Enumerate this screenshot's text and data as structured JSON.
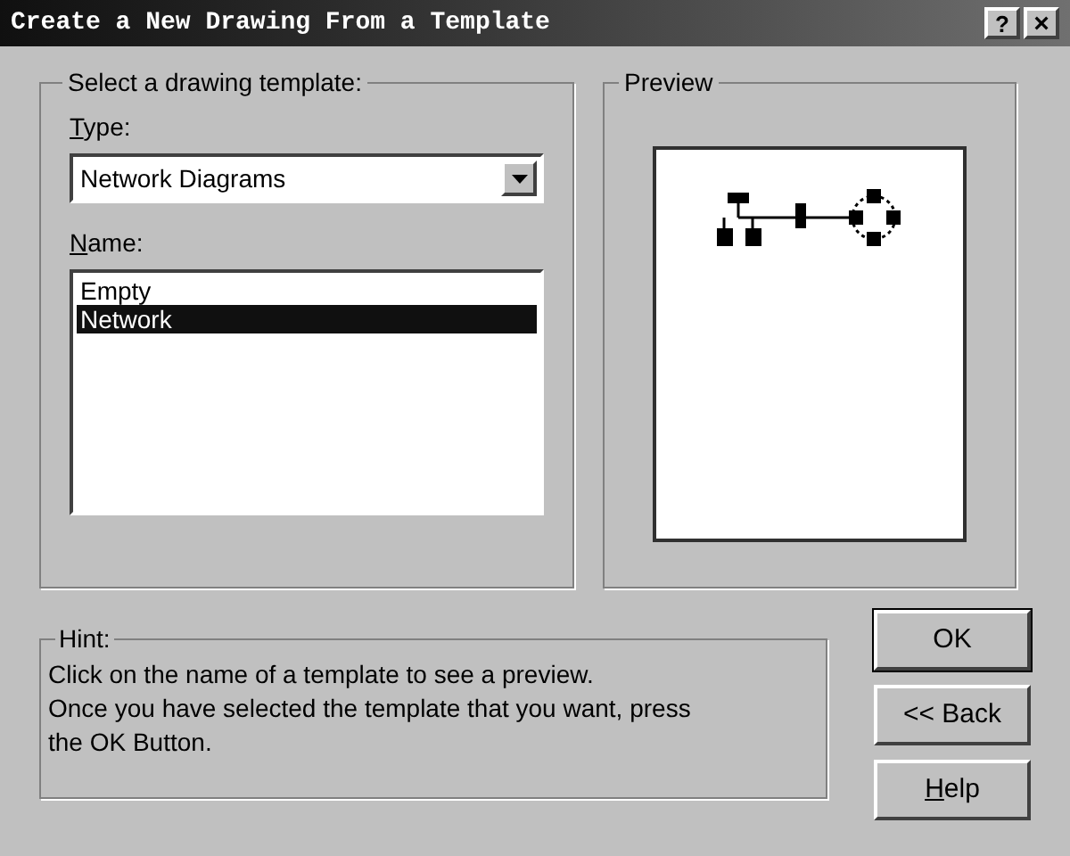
{
  "window": {
    "title": "Create a New Drawing From a Template",
    "help_glyph": "?",
    "close_glyph": "×"
  },
  "template_group": {
    "legend": "Select a drawing template:",
    "type_label": {
      "mnemonic": "T",
      "rest": "ype:"
    },
    "type_value": "Network Diagrams",
    "name_label": {
      "mnemonic": "N",
      "rest": "ame:"
    },
    "names": [
      {
        "label": "Empty",
        "selected": false
      },
      {
        "label": "Network",
        "selected": true
      }
    ]
  },
  "preview": {
    "legend": "Preview"
  },
  "hint": {
    "legend": "Hint:",
    "lines": [
      "Click on the name of a template to see a preview.",
      "Once you have selected the template that you want, press",
      "the OK Button."
    ]
  },
  "buttons": [
    {
      "rest": "OK",
      "default": true
    },
    {
      "rest": "<< Back",
      "default": false
    },
    {
      "mnemonic": "H",
      "rest": "elp",
      "default": false
    }
  ]
}
